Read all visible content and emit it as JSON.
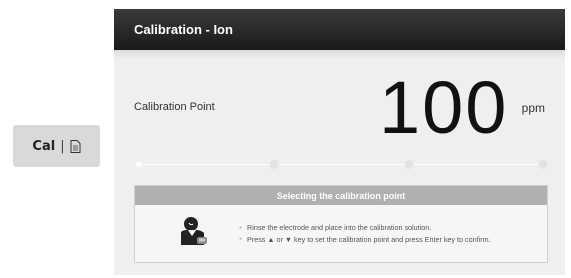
{
  "side_button": {
    "label": "Cal",
    "separator": "|",
    "icon": "document-icon"
  },
  "window": {
    "title": "Calibration - Ion"
  },
  "calibration": {
    "label": "Calibration Point",
    "value": "100",
    "unit": "ppm",
    "points_total": 4,
    "current_point": 1
  },
  "info": {
    "header": "Selecting the calibration point",
    "icon": "technician-icon",
    "bullets": [
      "Rinse the electrode and place into the calibration solution.",
      "Press ▲ or ▼ key to set the calibration point and press Enter key to confirm."
    ]
  }
}
